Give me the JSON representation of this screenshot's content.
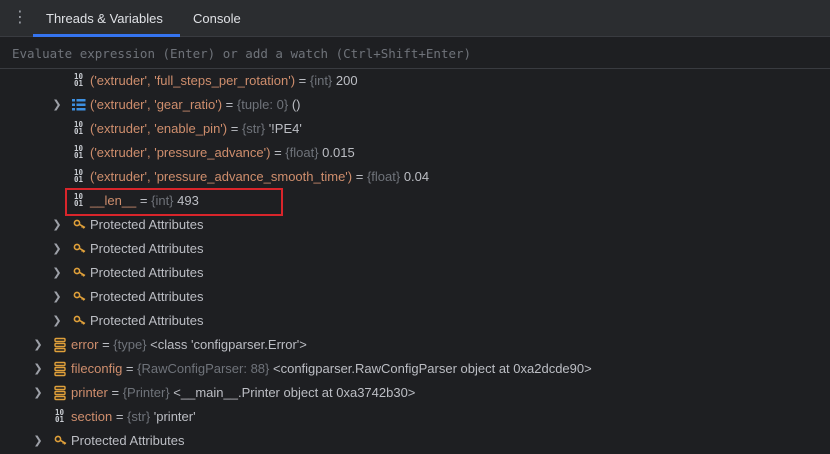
{
  "tabs": [
    {
      "label": "Threads & Variables",
      "active": true
    },
    {
      "label": "Console",
      "active": false
    }
  ],
  "evaluate": {
    "placeholder": "Evaluate expression (Enter) or add a watch (Ctrl+Shift+Enter)"
  },
  "rows": [
    {
      "name": "('extruder', 'full_steps_per_rotation')",
      "eq": " = ",
      "type": "{int}",
      "value": " 200",
      "icon": "int-icon",
      "expandable": false
    },
    {
      "name": "('extruder', 'gear_ratio')",
      "eq": " = ",
      "type": "{tuple: 0}",
      "value": " ()",
      "icon": "list-icon",
      "expandable": true
    },
    {
      "name": "('extruder', 'enable_pin')",
      "eq": " = ",
      "type": "{str}",
      "value": " '!PE4'",
      "icon": "int-icon",
      "expandable": false
    },
    {
      "name": "('extruder', 'pressure_advance')",
      "eq": " = ",
      "type": "{float}",
      "value": " 0.015",
      "icon": "int-icon",
      "expandable": false
    },
    {
      "name": "('extruder', 'pressure_advance_smooth_time')",
      "eq": " = ",
      "type": "{float}",
      "value": " 0.04",
      "icon": "int-icon",
      "expandable": false
    },
    {
      "name": "__len__",
      "eq": " = ",
      "type": "{int}",
      "value": " 493",
      "icon": "int-icon",
      "expandable": false
    },
    {
      "label": "Protected Attributes"
    },
    {
      "label": "Protected Attributes"
    },
    {
      "label": "Protected Attributes"
    },
    {
      "label": "Protected Attributes"
    },
    {
      "label": "Protected Attributes"
    },
    {
      "name": "error",
      "eq": " = ",
      "type": "{type}",
      "value": " <class 'configparser.Error'>"
    },
    {
      "name": "fileconfig",
      "eq": " = ",
      "type": "{RawConfigParser: 88}",
      "value": " <configparser.RawConfigParser object at 0xa2dcde90>"
    },
    {
      "name": "printer",
      "eq": " = ",
      "type": "{Printer}",
      "value": " <__main__.Printer object at 0xa3742b30>"
    },
    {
      "name": "section",
      "eq": " = ",
      "type": "{str}",
      "value": " 'printer'"
    },
    {
      "label": "Protected Attributes"
    }
  ],
  "binary_icon": {
    "top": "10",
    "bottom": "01"
  },
  "colors": {
    "name": "#cf8e6d",
    "type": "#6f737a",
    "value": "#bcbec4",
    "highlight": "#d9252b",
    "accent": "#3574f0"
  }
}
